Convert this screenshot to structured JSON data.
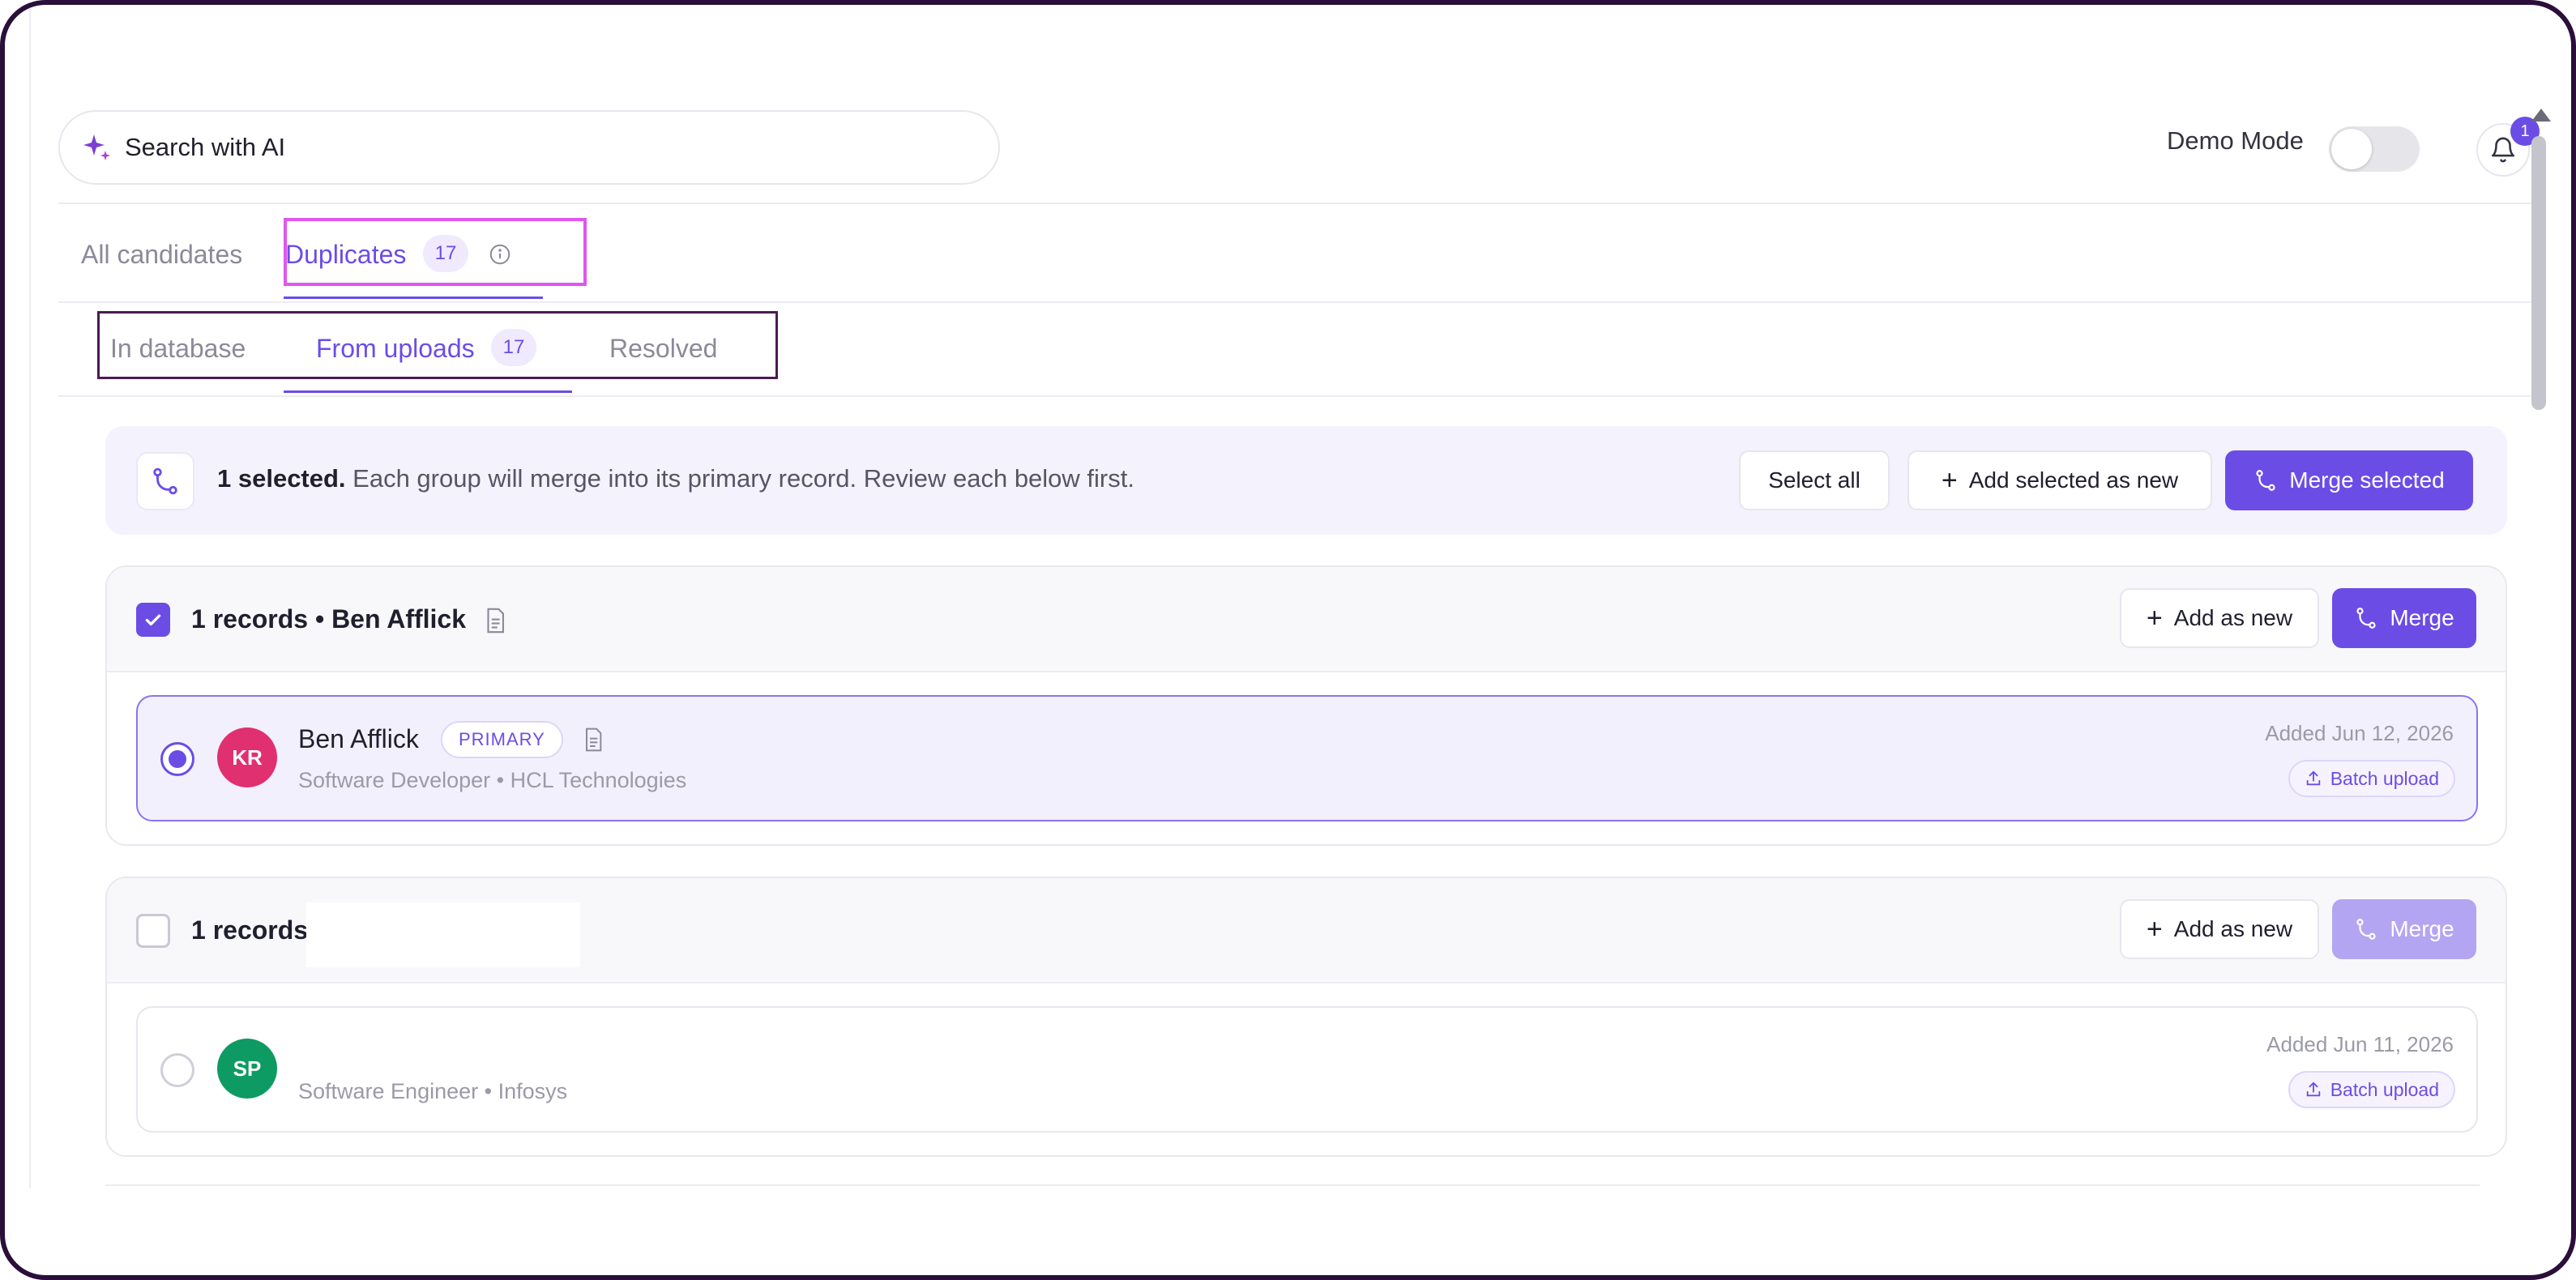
{
  "header": {
    "search_placeholder": "Search with AI",
    "demo_mode_label": "Demo Mode",
    "demo_mode_on": false,
    "notification_count": "1"
  },
  "tabs": {
    "primary": [
      {
        "label": "All candidates",
        "active": false
      },
      {
        "label": "Duplicates",
        "count": "17",
        "active": true
      }
    ],
    "secondary": [
      {
        "label": "In database",
        "active": false
      },
      {
        "label": "From uploads",
        "count": "17",
        "active": true
      },
      {
        "label": "Resolved",
        "active": false
      }
    ]
  },
  "banner": {
    "bold": "1 selected.",
    "text": " Each group will merge into its primary record. Review each below first.",
    "select_all": "Select all",
    "add_selected": "Add selected as new",
    "merge_selected": "Merge selected"
  },
  "groups": [
    {
      "title": "1 records • Ben Afflick",
      "checked": true,
      "add_label": "Add as new",
      "merge_label": "Merge",
      "merge_enabled": true,
      "record": {
        "name": "Ben Afflick",
        "badge": "PRIMARY",
        "initials": "KR",
        "avatar_color": "#e0306f",
        "subtitle": "Software Developer • HCL Technologies",
        "added": "Added Jun 12, 2026",
        "source": "Batch upload",
        "selected": true
      }
    },
    {
      "title": "1 records",
      "checked": false,
      "add_label": "Add as new",
      "merge_label": "Merge",
      "merge_enabled": false,
      "record": {
        "name": "",
        "initials": "SP",
        "avatar_color": "#0e9a63",
        "subtitle": "Software Engineer • Infosys",
        "added": "Added Jun 11, 2026",
        "source": "Batch upload",
        "selected": false
      }
    }
  ],
  "colors": {
    "accent": "#6b4de6",
    "highlight_pink": "#e056ef",
    "highlight_dark": "#4b1a54"
  }
}
